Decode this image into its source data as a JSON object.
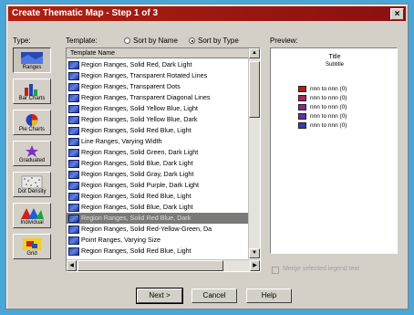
{
  "window": {
    "title": "Create Thematic Map - Step 1 of 3",
    "close_glyph": "×"
  },
  "types": {
    "label": "Type:",
    "items": [
      {
        "label": "Ranges",
        "icon": "ranges-icon"
      },
      {
        "label": "Bar Charts",
        "icon": "bar-charts-icon"
      },
      {
        "label": "Pie Charts",
        "icon": "pie-charts-icon"
      },
      {
        "label": "Graduated",
        "icon": "graduated-icon"
      },
      {
        "label": "Dot Density",
        "icon": "dot-density-icon"
      },
      {
        "label": "Individual",
        "icon": "individual-icon"
      },
      {
        "label": "Grid",
        "icon": "grid-icon"
      }
    ]
  },
  "templates": {
    "label": "Template:",
    "sort_by_name": "Sort by Name",
    "sort_by_type": "Sort by Type",
    "sort_selected": "type",
    "column_header": "Template Name",
    "selected_index": 14,
    "rows": [
      "Region Ranges, Solid Red, Dark Light",
      "Region Ranges, Transparent Rotated Lines",
      "Region Ranges, Transparent Dots",
      "Region Ranges, Transparent Diagonal Lines",
      "Region Ranges, Solid Yellow Blue, Light",
      "Region Ranges, Solid Yellow Blue, Dark",
      "Region Ranges, Solid Red Blue, Light",
      "Line Ranges, Varying Width",
      "Region Ranges, Solid Green, Dark Light",
      "Region Ranges, Solid Blue, Dark Light",
      "Region Ranges, Solid Gray, Dark Light",
      "Region Ranges, Solid Purple, Dark Light",
      "Region Ranges, Solid Red Blue, Light",
      "Region Ranges, Solid Blue, Dark Light",
      "Region Ranges, Solid Red Blue, Dark",
      "Region Ranges, Solid Red-Yellow-Green, Da",
      "Point Ranges, Varying Size",
      "Region Ranges, Solid Red Blue, Light"
    ]
  },
  "preview": {
    "label": "Preview:",
    "title": "Title",
    "subtitle": "Subtitle",
    "legend": [
      {
        "text": "nnn to nnn (0)",
        "color": "#c01818"
      },
      {
        "text": "nnn to nnn (0)",
        "color": "#b02060"
      },
      {
        "text": "nnn to nnn (0)",
        "color": "#8a2890"
      },
      {
        "text": "nnn to nnn (0)",
        "color": "#6030a8"
      },
      {
        "text": "nnn to nnn (0)",
        "color": "#3838b8"
      }
    ]
  },
  "merge_label": "Merge selected legend text",
  "buttons": {
    "next": "Next >",
    "cancel": "Cancel",
    "help": "Help"
  }
}
